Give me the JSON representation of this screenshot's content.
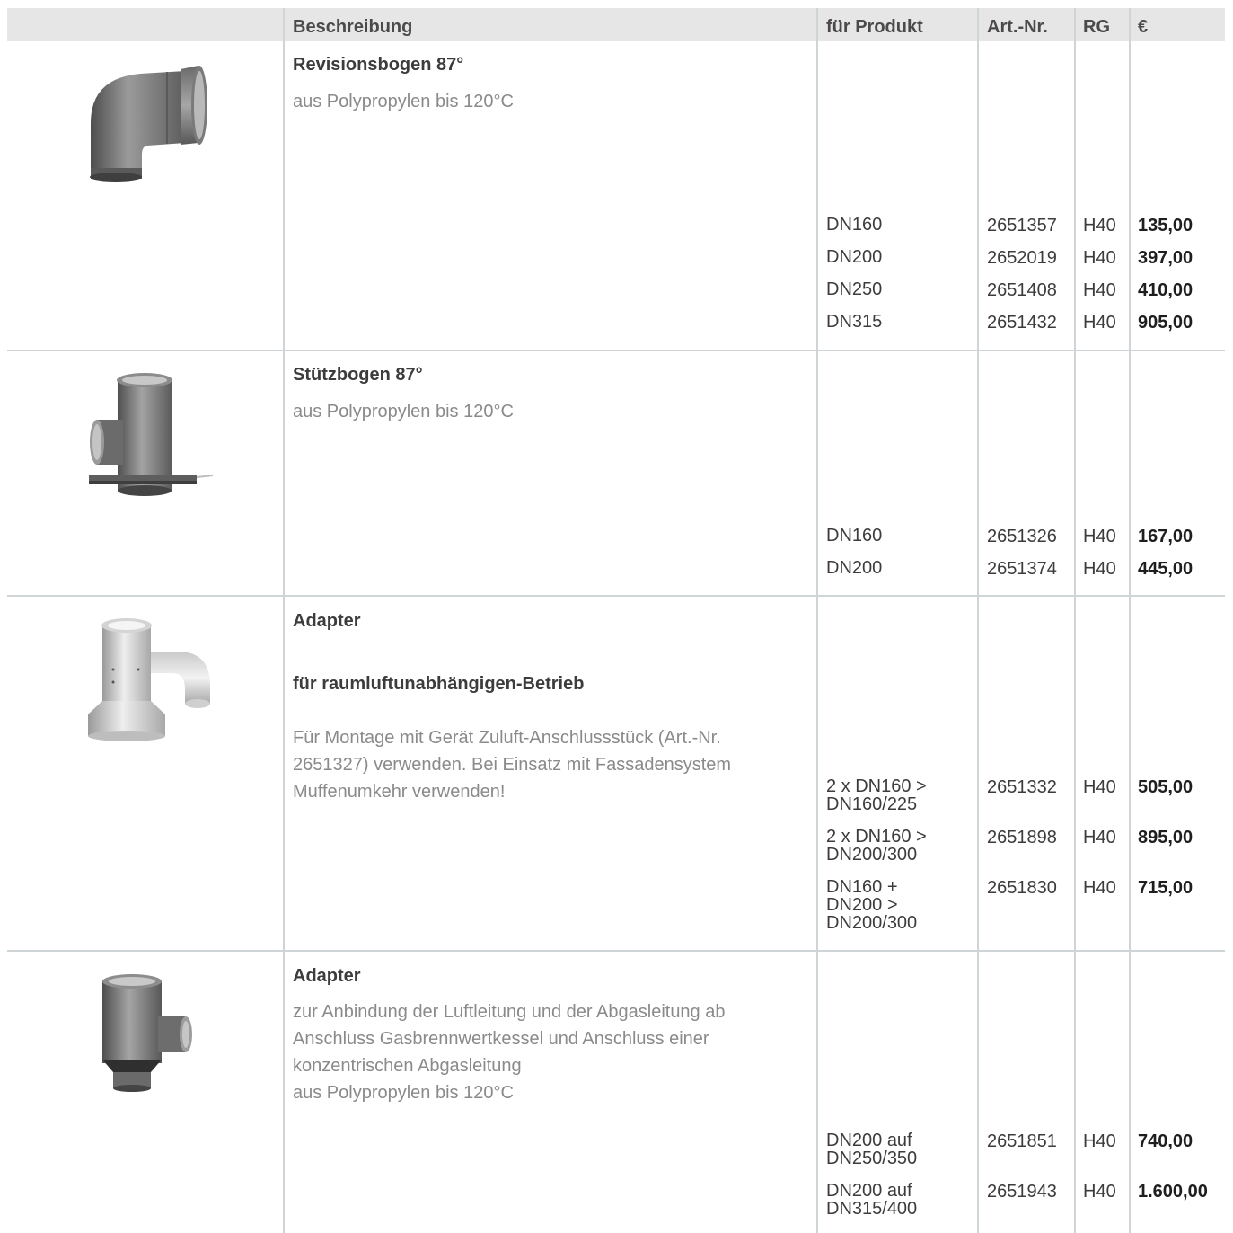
{
  "header": {
    "beschreibung": "Beschreibung",
    "fuer_produkt": "für Produkt",
    "art_nr": "Art.-Nr.",
    "rg": "RG",
    "currency": "€"
  },
  "products": [
    {
      "title": "Revisionsbogen 87°",
      "description": "aus Polypropylen bis 120°C",
      "image_icon": "elbow-pipe-icon",
      "rows": [
        {
          "product": "DN160",
          "art_nr": "2651357",
          "rg": "H40",
          "price": "135,00"
        },
        {
          "product": "DN200",
          "art_nr": "2652019",
          "rg": "H40",
          "price": "397,00"
        },
        {
          "product": "DN250",
          "art_nr": "2651408",
          "rg": "H40",
          "price": "410,00"
        },
        {
          "product": "DN315",
          "art_nr": "2651432",
          "rg": "H40",
          "price": "905,00"
        }
      ]
    },
    {
      "title": "Stützbogen 87°",
      "description": "aus Polypropylen bis 120°C",
      "image_icon": "support-tee-pipe-icon",
      "rows": [
        {
          "product": "DN160",
          "art_nr": "2651326",
          "rg": "H40",
          "price": "167,00"
        },
        {
          "product": "DN200",
          "art_nr": "2651374",
          "rg": "H40",
          "price": "445,00"
        }
      ]
    },
    {
      "title": "Adapter",
      "subtitle": "für raumluftunabhängigen-Betrieb",
      "description": "Für Montage mit Gerät Zuluft-Anschlussstück (Art.-Nr. 2651327) verwenden. Bei Einsatz mit Fassadensystem Muffenumkehr verwenden!",
      "image_icon": "adapter-elbow-pipe-icon",
      "rows": [
        {
          "product": "2 x DN160 >\nDN160/225",
          "art_nr": "2651332",
          "rg": "H40",
          "price": "505,00"
        },
        {
          "product": "2 x DN160 >\nDN200/300",
          "art_nr": "2651898",
          "rg": "H40",
          "price": "895,00"
        },
        {
          "product": "DN160 +\nDN200 >\nDN200/300",
          "art_nr": "2651830",
          "rg": "H40",
          "price": "715,00"
        }
      ]
    },
    {
      "title": "Adapter",
      "description": "zur Anbindung der Luftleitung und der Abgasleitung ab Anschluss Gasbrennwertkessel und Anschluss einer konzentrischen Abgasleitung\naus Polypropylen bis 120°C",
      "image_icon": "adapter-tee-pipe-icon",
      "rows": [
        {
          "product": "DN200 auf\nDN250/350",
          "art_nr": "2651851",
          "rg": "H40",
          "price": "740,00"
        },
        {
          "product": "DN200 auf\nDN315/400",
          "art_nr": "2651943",
          "rg": "H40",
          "price": "1.600,00"
        }
      ]
    }
  ]
}
